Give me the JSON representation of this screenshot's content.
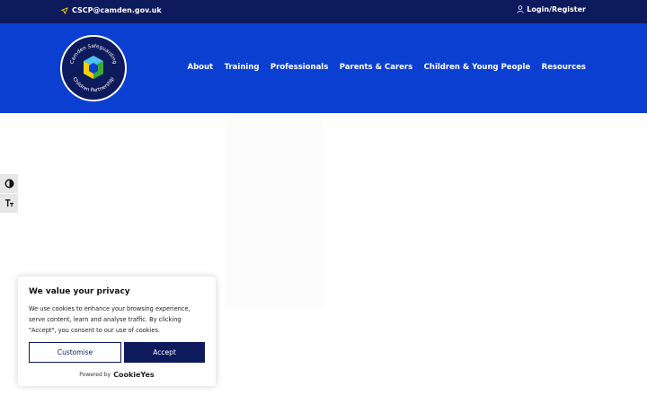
{
  "topbar": {
    "email": "CSCP@camden.gov.uk",
    "login": "Login/Register"
  },
  "header": {
    "logo": {
      "text_top": "Camden Safeguarding",
      "text_bottom": "Children Partnership"
    },
    "nav": [
      "About",
      "Training",
      "Professionals",
      "Parents & Carers",
      "Children & Young People",
      "Resources"
    ]
  },
  "accessibility": {
    "icons": [
      "contrast-icon",
      "text-size-icon"
    ]
  },
  "cookie_banner": {
    "title": "We value your privacy",
    "body": "We use cookies to enhance your browsing experience, serve content, learn and analyse traffic. By clicking \"Accept\", you consent to our use of cookies.",
    "customise_label": "Customise",
    "accept_label": "Accept",
    "powered_by": "Powered by",
    "brand": "CookieYes"
  },
  "colors": {
    "topbar": "#0d1a5c",
    "header": "#0b3fd2",
    "accept_button": "#0d1a5c"
  }
}
